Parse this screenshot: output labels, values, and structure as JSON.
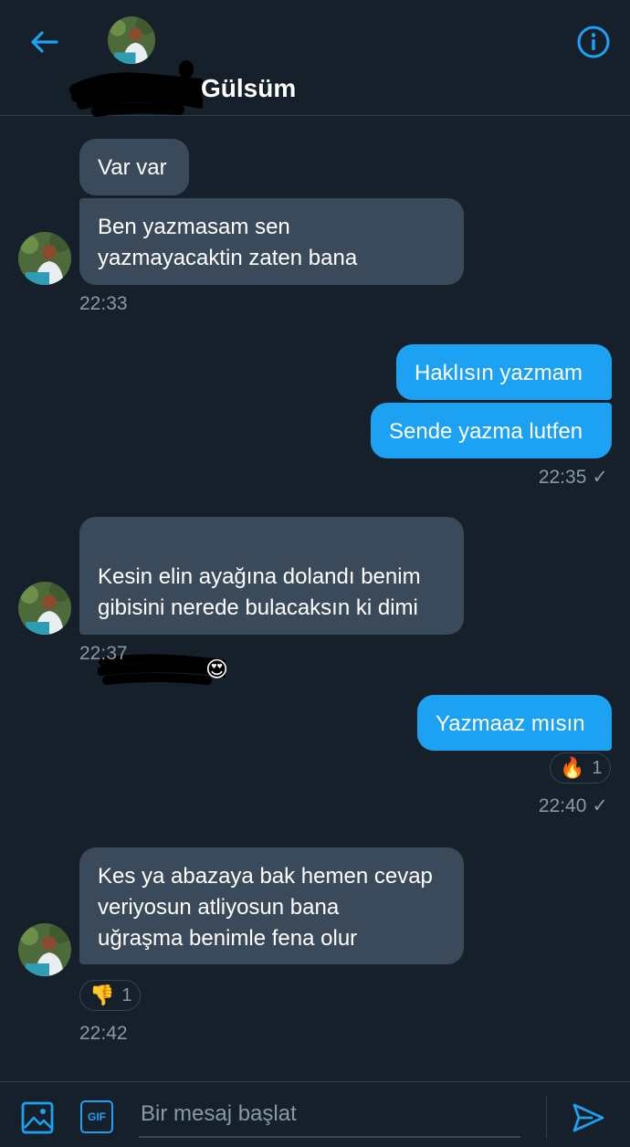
{
  "header": {
    "contact_name": "Gülsüm",
    "icons": {
      "back": "arrow-left-icon",
      "info": "info-icon"
    }
  },
  "colors": {
    "background": "#15202b",
    "incoming_bubble": "#3a4a5a",
    "outgoing_bubble": "#1da1f2",
    "accent": "#1da1f2",
    "muted_text": "#8899a6"
  },
  "messages": [
    {
      "direction": "in",
      "text": "Var var"
    },
    {
      "direction": "in",
      "text": "Ben yazmasam sen\nyazmayacaktin zaten bana",
      "time": "22:33"
    },
    {
      "direction": "out",
      "text": "Haklısın yazmam"
    },
    {
      "direction": "out",
      "text": "Sende yazma lutfen",
      "time": "22:35",
      "status": "✓"
    },
    {
      "direction": "in",
      "text": "Kesin elin ayağına dolandı  benim\ngibisini nerede bulacaksın ki dimi",
      "emoji": "😍",
      "time": "22:37"
    },
    {
      "direction": "out",
      "text": "Yazmaaz mısın",
      "reaction": {
        "emoji": "🔥",
        "count": "1"
      },
      "time": "22:40",
      "status": "✓"
    },
    {
      "direction": "in",
      "text": "Kes ya abazaya bak hemen cevap\nveriyosun atliyosun bana\nuğraşma benimle fena olur",
      "reaction": {
        "emoji": "👎",
        "count": "1"
      },
      "time": "22:42"
    }
  ],
  "composer": {
    "placeholder": "Bir mesaj başlat",
    "gif_label": "GIF",
    "icons": {
      "image": "image-icon",
      "gif": "gif-icon",
      "send": "send-icon"
    }
  }
}
